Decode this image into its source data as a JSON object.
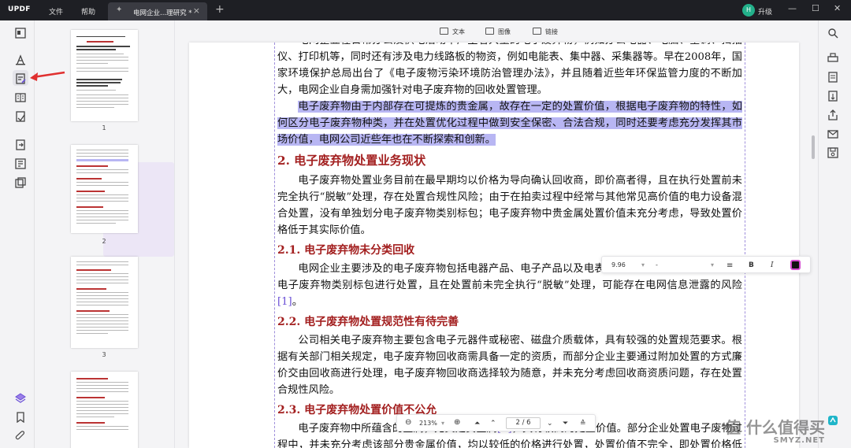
{
  "titlebar": {
    "logo": "UPDF",
    "menu": [
      "文件",
      "帮助"
    ],
    "tab_title": "电网企业...理研究 *",
    "tab_close": "×",
    "new_tab": "+",
    "avatar_letter": "H",
    "upgrade": "升级",
    "win_controls": [
      "—",
      "☐",
      "✕"
    ]
  },
  "thumbnails": [
    "1",
    "2",
    "3"
  ],
  "toolbar": {
    "text": "文本",
    "image": "图像",
    "link": "链接"
  },
  "document": {
    "para1_top": "电网企业在日常办公及供电活动中产生着大量的电子废弃物，例如办公电器、电脑、空调、扫描仪、打印机等，同时还有涉及电力线路板的物资，例如电能表、集中器、采集器等。早在2008年，国家环境保护总局出台了《电子废物污染环境防治管理办法》，并且随着近些年环保监管力度的不断加大，电网企业自身需加强针对电子废弃物的回收处置管理。",
    "para1_sel": "电子废弃物由于内部存在可提炼的贵金属，故存在一定的处置价值，根据电子废弃物的特性，如何区分电子废弃物种类，并在处置优化过程中做到安全保密、合法合规，同时还要考虑充分发挥其市场价值，电网公司近些年也在不断探索和创新。",
    "h2": "2. 电子废弃物处置业务现状",
    "para2": "电子废弃物处置业务目前在最早期均以价格为导向确认回收商，即价高者得，且在执行处置前未完全执行“脱敏”处理，存在处置合规性风险；由于在拍卖过程中经常与其他常见高价值的电力设备混合处置，没有单独划分电子废弃物类别标包；电子废弃物中贵金属处置价值未充分考虑，导致处置价格低于其实际价值。",
    "h3_1": "2.1. 电子废弃物未分类回收",
    "para3": "电网企业主要涉及的电子废弃物包括电器产品、电子产品以及电表等，部分企业并没有单独划分电子废弃物类别标包进行处置，且在处置前未完全执行“脱敏”处理，可能存在电网信息泄露的风险",
    "ref1": "[1]",
    "para3_end": "。",
    "h3_2": "2.2. 电子废弃物处置规范性有待完善",
    "para4": "公司相关电子废弃物主要包含电子元器件或秘密、磁盘介质载体，具有较强的处置规范要求。根据有关部门相关规定，电子废弃物回收商需具备一定的资质，而部分企业主要通过附加处置的方式廉价交由回收商进行处理，电子废弃物回收商选择较为随意，并未充分考虑回收商资质问题，存在处置合规性风险。",
    "h3_3": "2.3. 电子废弃物处置价值不公允",
    "para5a": "电子废弃物中所蕴含的金属，尤其是贵金属",
    "ref2": "[2]",
    "para5b": "，具有较高的处置价值。部分企业处置电子废物过程中，并未充分考虑该部分贵金属价值，均以较低的价格进行处置，处置价值不完全，即处置价格低于"
  },
  "float_toolbar": {
    "size": "9.96",
    "font": "-",
    "bold": "B",
    "italic": "I",
    "text_color": "#111111"
  },
  "bottom_bar": {
    "zoom": "213%",
    "page": "2 / 6"
  },
  "watermark": {
    "text": "值 什么值得买",
    "sub": "SMYZ.NET"
  },
  "colors": {
    "accent": "#6a4fd6",
    "heading": "#a32020",
    "selection": "#b8b6f3",
    "titlebar": "#1e1f24"
  }
}
